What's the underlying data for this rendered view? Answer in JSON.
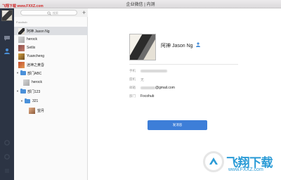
{
  "window": {
    "title": "企业微信 | 内测"
  },
  "watermark_top": "飞翔下载 www.FXXZ.com",
  "search": {
    "placeholder": "搜索"
  },
  "list": {
    "section": "Focohub",
    "items": [
      {
        "label": "阿神 Jason Ng",
        "selected": true
      },
      {
        "label": "herock"
      },
      {
        "label": "Setlix"
      },
      {
        "label": "Yuancheng"
      },
      {
        "label": "迷神之黄昏"
      },
      {
        "label": "部门ABC"
      },
      {
        "label": "herock"
      },
      {
        "label": "部门123"
      },
      {
        "label": "321"
      },
      {
        "label": "望月"
      }
    ]
  },
  "profile": {
    "name": "阿神 Jason Ng",
    "fields": [
      {
        "label": "手机",
        "value": ""
      },
      {
        "label": "座机",
        "value": "无"
      },
      {
        "label": "邮箱",
        "value": "@gmail.com"
      },
      {
        "label": "部门",
        "value": "Focohub"
      }
    ],
    "button": "发消息"
  },
  "watermark": {
    "text": "飞翔下载",
    "url": "www.FXXZ.com"
  }
}
